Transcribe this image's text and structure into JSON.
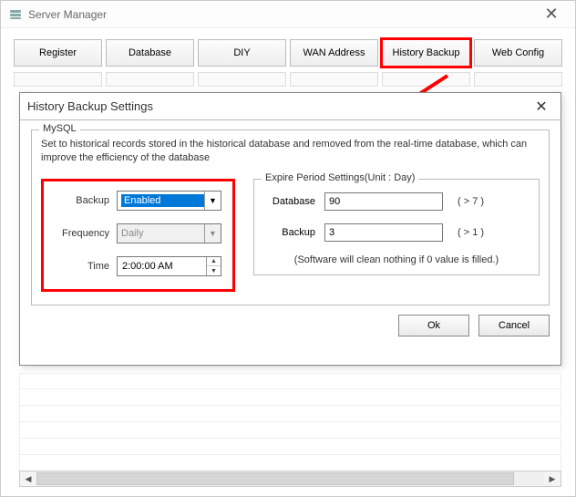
{
  "window": {
    "title": "Server Manager"
  },
  "tabs": [
    {
      "label": "Register"
    },
    {
      "label": "Database"
    },
    {
      "label": "DIY"
    },
    {
      "label": "WAN Address"
    },
    {
      "label": "History Backup",
      "highlighted": true
    },
    {
      "label": "Web Config"
    }
  ],
  "dialog": {
    "title": "History Backup Settings",
    "mysql_legend": "MySQL",
    "description": "Set to historical records stored in the historical database and removed from the real-time database, which can improve the efficiency of the database",
    "backup_label": "Backup",
    "backup_value": "Enabled",
    "frequency_label": "Frequency",
    "frequency_value": "Daily",
    "time_label": "Time",
    "time_value": "2:00:00 AM",
    "expire_legend": "Expire Period Settings(Unit : Day)",
    "database_label": "Database",
    "database_value": "90",
    "database_hint": "( > 7 )",
    "backup2_label": "Backup",
    "backup2_value": "3",
    "backup2_hint": "( > 1 )",
    "note": "(Software will clean nothing if 0 value is filled.)",
    "ok": "Ok",
    "cancel": "Cancel"
  }
}
